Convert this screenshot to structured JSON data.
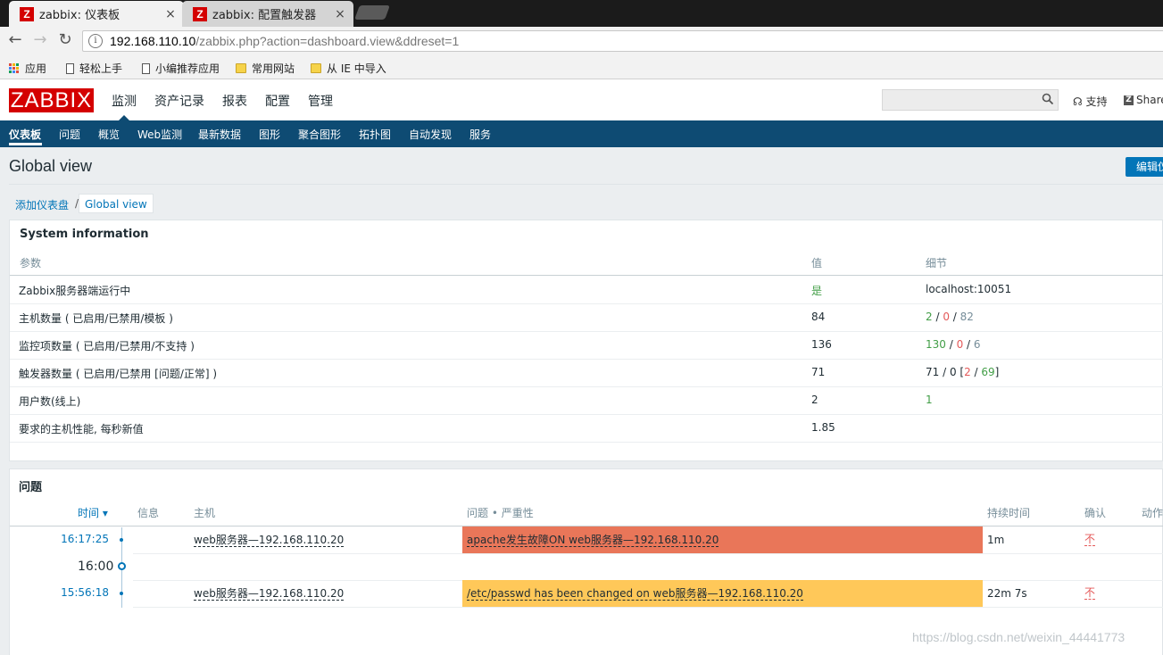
{
  "browser": {
    "tabs": [
      {
        "title": "zabbix: 仪表板",
        "close": "×",
        "icon": "Z"
      },
      {
        "title": "zabbix: 配置触发器",
        "close": "×",
        "icon": "Z"
      }
    ],
    "nav": {
      "back": "←",
      "forward": "→",
      "reload": "↻"
    },
    "url_host": "192.168.110.10",
    "url_path": "/zabbix.php?action=dashboard.view&ddreset=1",
    "bookmarks": [
      {
        "label": "应用",
        "icon": "apps-icon"
      },
      {
        "label": "轻松上手",
        "icon": "page-icon"
      },
      {
        "label": "小编推荐应用",
        "icon": "page-icon"
      },
      {
        "label": "常用网站",
        "icon": "folder-icon"
      },
      {
        "label": "从 IE 中导入",
        "icon": "folder-icon"
      }
    ]
  },
  "header": {
    "logo": "ZABBIX",
    "menu": [
      "监测",
      "资产记录",
      "报表",
      "配置",
      "管理"
    ],
    "support": "支持",
    "share": "Share",
    "share_icon": "Z"
  },
  "submenu": [
    "仪表板",
    "问题",
    "概览",
    "Web监测",
    "最新数据",
    "图形",
    "聚合图形",
    "拓扑图",
    "自动发现",
    "服务"
  ],
  "page": {
    "title": "Global view",
    "edit_button": "编辑仪表盘",
    "breadcrumb": {
      "parent": "添加仪表盘",
      "separator": "/",
      "current": "Global view"
    }
  },
  "system_info": {
    "title": "System information",
    "columns": [
      "参数",
      "值",
      "细节"
    ],
    "rows": [
      {
        "param": "Zabbix服务器端运行中",
        "value": "是",
        "detail": "localhost:10051"
      },
      {
        "param": "主机数量 ( 已启用/已禁用/模板 )",
        "value": "84",
        "d1": "2",
        "s1": " / ",
        "d2": "0",
        "s2": " / ",
        "d3": "82"
      },
      {
        "param": "监控项数量 ( 已启用/已禁用/不支持 )",
        "value": "136",
        "d1": "130",
        "s1": " / ",
        "d2": "0",
        "s2": " / ",
        "d3": "6"
      },
      {
        "param": "触发器数量 ( 已启用/已禁用 [问题/正常] )",
        "value": "71",
        "d1": "71 / 0 [",
        "d2": "2",
        "s1": " / ",
        "d3": "69",
        "s2": "]"
      },
      {
        "param": "用户数(线上)",
        "value": "2",
        "detail": "1"
      },
      {
        "param": "要求的主机性能, 每秒新值",
        "value": "1.85",
        "detail": ""
      }
    ]
  },
  "problems": {
    "title": "问题",
    "columns": {
      "time": "时间 ▾",
      "info": "信息",
      "host": "主机",
      "problem": "问题 • 严重性",
      "duration": "持续时间",
      "ack": "确认",
      "actions": "动作"
    },
    "hour_marker": "16:00",
    "rows": [
      {
        "time": "16:17:25",
        "host": "web服务器—192.168.110.20",
        "problem": "apache发生故障ON web服务器—192.168.110.20",
        "duration": "1m",
        "ack": "不",
        "color": "#e97659"
      },
      {
        "time": "15:56:18",
        "host": "web服务器—192.168.110.20",
        "problem": "/etc/passwd has been changed on web服务器—192.168.110.20",
        "duration": "22m 7s",
        "ack": "不",
        "color": "#ffc859"
      }
    ]
  },
  "watermark": "https://blog.csdn.net/weixin_44441773"
}
